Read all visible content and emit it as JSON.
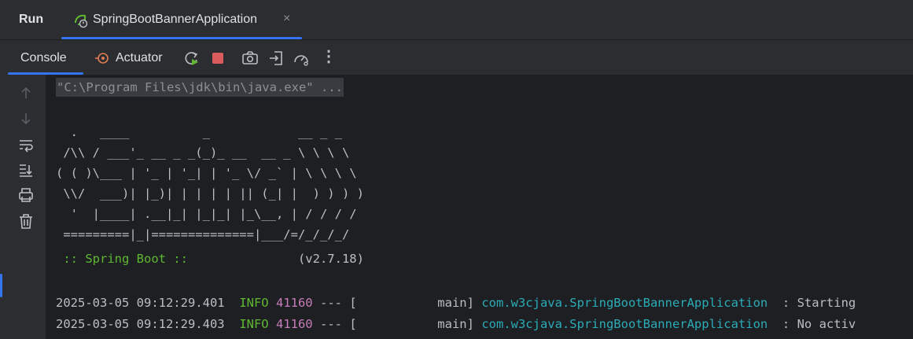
{
  "run_panel": {
    "title": "Run",
    "tab": {
      "label": "SpringBootBannerApplication",
      "close": "×"
    }
  },
  "toolbar": {
    "console_tab": "Console",
    "actuator_tab": "Actuator",
    "icons": [
      "rerun-icon",
      "stop-icon",
      "camera-icon",
      "exit-icon",
      "dashboard-icon",
      "more-icon"
    ],
    "more": "⋮"
  },
  "gutter": {
    "icons": [
      "arrow-up-icon",
      "arrow-down-icon",
      "soft-wrap-icon",
      "scroll-end-icon",
      "print-icon",
      "trash-icon"
    ]
  },
  "console": {
    "command": "\"C:\\Program Files\\jdk\\bin\\java.exe\" ...",
    "banner": [
      "  .   ____          _            __ _ _",
      " /\\\\ / ___'_ __ _ _(_)_ __  __ _ \\ \\ \\ \\",
      "( ( )\\___ | '_ | '_| | '_ \\/ _` | \\ \\ \\ \\",
      " \\\\/  ___)| |_)| | | | | || (_| |  ) ) ) )",
      "  '  |____| .__|_| |_|_| |_\\__, | / / / /",
      " =========|_|==============|___/=/_/_/_/"
    ],
    "boot_label": " :: Spring Boot :: ",
    "boot_version": "              (v2.7.18)",
    "logs": [
      {
        "timestamp": "2025-03-05 09:12:29.401",
        "level": "INFO",
        "pid": "41160",
        "sep": " --- [",
        "thread": "           main]",
        "logger": "com.w3cjava.SpringBootBannerApplication",
        "message": "  : Starting"
      },
      {
        "timestamp": "2025-03-05 09:12:29.403",
        "level": "INFO",
        "pid": "41160",
        "sep": " --- [",
        "thread": "           main]",
        "logger": "com.w3cjava.SpringBootBannerApplication",
        "message": "  : No activ"
      }
    ]
  },
  "colors": {
    "accent": "#3574f0",
    "info": "#5fb832",
    "pid": "#c77dbb",
    "logger": "#2aacb8",
    "stop": "#db5c5c"
  }
}
